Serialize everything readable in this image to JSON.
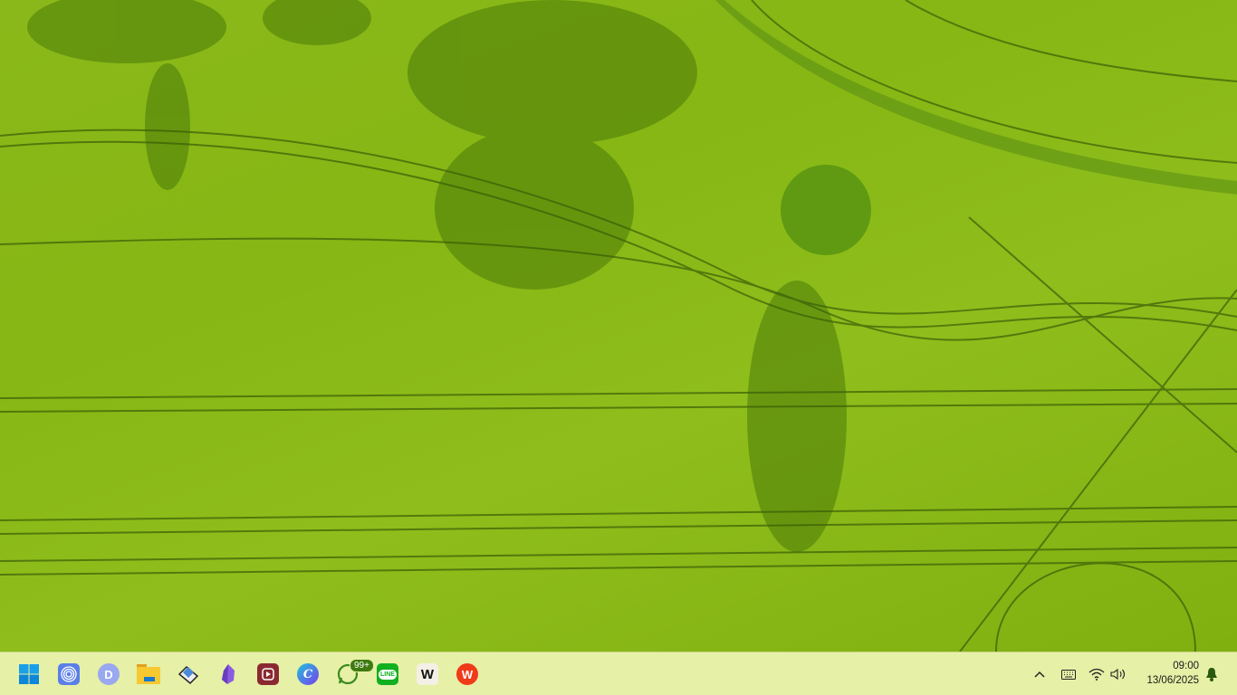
{
  "taskbar": {
    "apps": [
      {
        "name": "start",
        "icon": "windows-logo-icon"
      },
      {
        "name": "app-circles",
        "icon": "concentric-circles-icon"
      },
      {
        "name": "app-d",
        "icon": "d-logo-icon"
      },
      {
        "name": "file-explorer",
        "icon": "folder-icon"
      },
      {
        "name": "drawing-app",
        "icon": "pencil-book-icon"
      },
      {
        "name": "obsidian",
        "icon": "crystal-icon"
      },
      {
        "name": "video-recorder",
        "icon": "play-screen-icon"
      },
      {
        "name": "canva",
        "icon": "canva-icon",
        "glyph": "C"
      },
      {
        "name": "whatsapp",
        "icon": "whatsapp-icon",
        "badge": "99+"
      },
      {
        "name": "line",
        "icon": "line-icon",
        "glyph": "LINE"
      },
      {
        "name": "wps-writer",
        "icon": "w-logo-icon",
        "glyph": "W"
      },
      {
        "name": "wps-office",
        "icon": "wps-icon",
        "glyph": "W"
      }
    ],
    "tray": {
      "time": "09:00",
      "date": "13/06/2025"
    }
  },
  "colors": {
    "taskbar": "#e6f0a6",
    "wallpaper": "#86b714"
  }
}
